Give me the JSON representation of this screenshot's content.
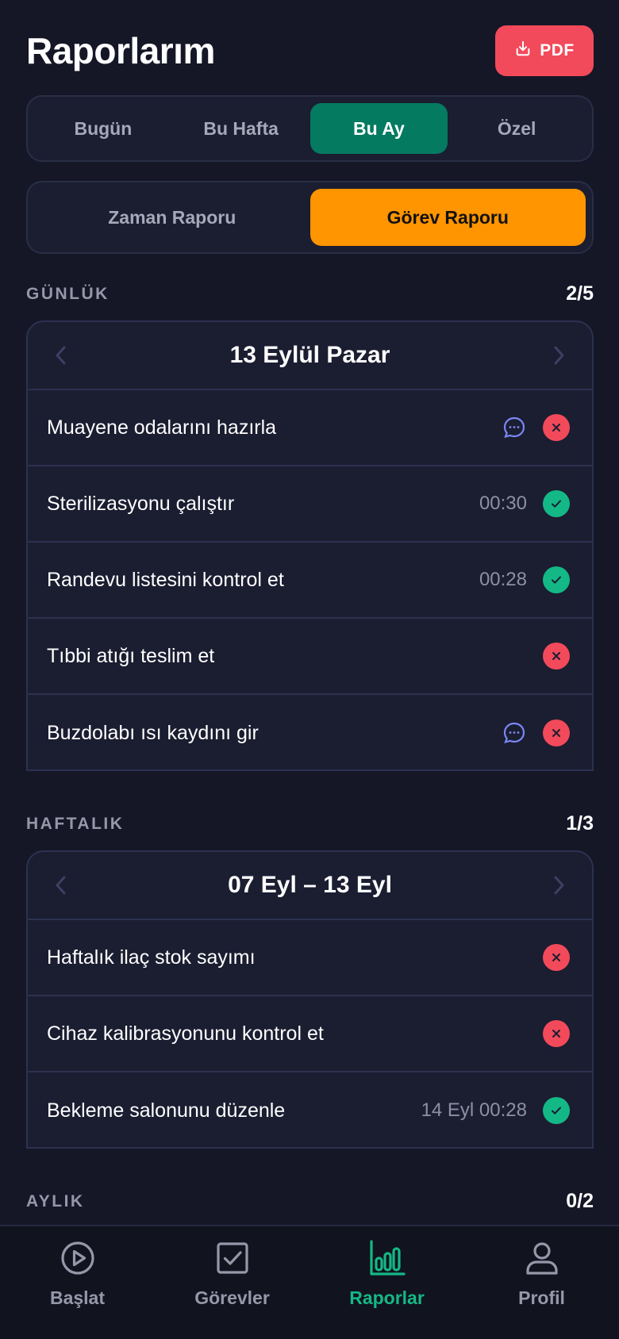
{
  "header": {
    "title": "Raporlarım",
    "pdf_label": "PDF"
  },
  "period_tabs": [
    {
      "label": "Bugün",
      "active": false
    },
    {
      "label": "Bu Hafta",
      "active": false
    },
    {
      "label": "Bu Ay",
      "active": true
    },
    {
      "label": "Özel",
      "active": false
    }
  ],
  "report_tabs": [
    {
      "label": "Zaman Raporu",
      "active": false
    },
    {
      "label": "Görev Raporu",
      "active": true
    }
  ],
  "sections": {
    "daily": {
      "label": "GÜNLÜK",
      "count": "2/5",
      "period": "13 Eylül Pazar",
      "items": [
        {
          "label": "Muayene odalarını hazırla",
          "time": "",
          "comment": true,
          "status": "fail"
        },
        {
          "label": "Sterilizasyonu çalıştır",
          "time": "00:30",
          "comment": false,
          "status": "ok"
        },
        {
          "label": "Randevu listesini kontrol et",
          "time": "00:28",
          "comment": false,
          "status": "ok"
        },
        {
          "label": "Tıbbi atığı teslim et",
          "time": "",
          "comment": false,
          "status": "fail"
        },
        {
          "label": "Buzdolabı ısı kaydını gir",
          "time": "",
          "comment": true,
          "status": "fail"
        }
      ]
    },
    "weekly": {
      "label": "HAFTALIK",
      "count": "1/3",
      "period": "07 Eyl – 13 Eyl",
      "items": [
        {
          "label": "Haftalık ilaç stok sayımı",
          "time": "",
          "comment": false,
          "status": "fail"
        },
        {
          "label": "Cihaz kalibrasyonunu kontrol et",
          "time": "",
          "comment": false,
          "status": "fail"
        },
        {
          "label": "Bekleme salonunu düzenle",
          "time": "14 Eyl 00:28",
          "comment": false,
          "status": "ok"
        }
      ]
    },
    "monthly": {
      "label": "AYLIK",
      "count": "0/2"
    }
  },
  "bottom_nav": [
    {
      "label": "Başlat",
      "icon": "play-circle-icon",
      "active": false
    },
    {
      "label": "Görevler",
      "icon": "checkbox-icon",
      "active": false
    },
    {
      "label": "Raporlar",
      "icon": "bar-chart-icon",
      "active": true
    },
    {
      "label": "Profil",
      "icon": "user-icon",
      "active": false
    }
  ],
  "colors": {
    "background": "#151727",
    "accent_green": "#047a61",
    "accent_orange": "#ff9500",
    "danger": "#f24a5a",
    "success": "#14b886",
    "comment": "#7b87f5"
  }
}
